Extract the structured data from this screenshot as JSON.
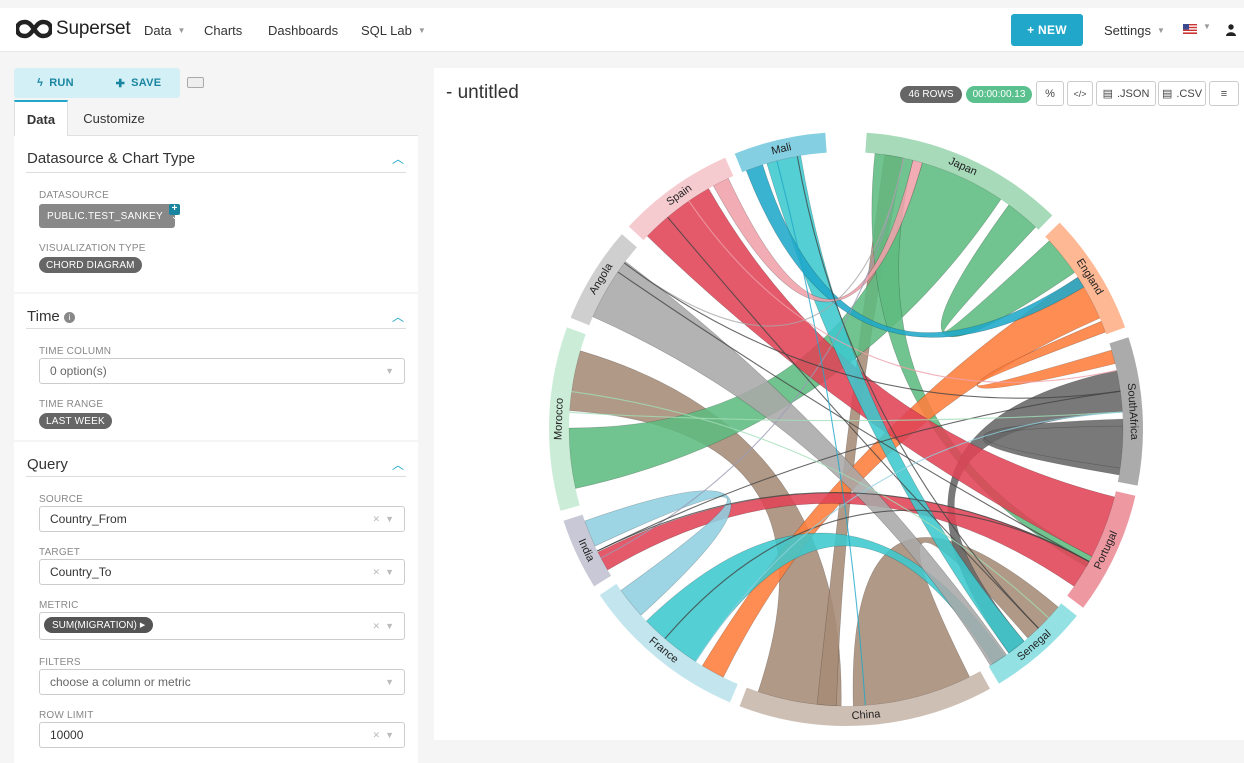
{
  "nav": {
    "brand": "Superset",
    "items": [
      "Data",
      "Charts",
      "Dashboards",
      "SQL Lab"
    ],
    "new_label": "+ NEW",
    "settings_label": "Settings"
  },
  "controls": {
    "run_label": "RUN",
    "save_label": "SAVE",
    "tabs": [
      "Data",
      "Customize"
    ]
  },
  "sections": {
    "datasource": {
      "title": "Datasource & Chart Type",
      "datasource_label": "DATASOURCE",
      "datasource_value": "PUBLIC.TEST_SANKEY",
      "viz_label": "VISUALIZATION TYPE",
      "viz_value": "CHORD DIAGRAM"
    },
    "time": {
      "title": "Time",
      "column_label": "TIME COLUMN",
      "column_value": "0 option(s)",
      "range_label": "TIME RANGE",
      "range_value": "LAST WEEK"
    },
    "query": {
      "title": "Query",
      "source_label": "SOURCE",
      "source_value": "Country_From",
      "target_label": "TARGET",
      "target_value": "Country_To",
      "metric_label": "METRIC",
      "metric_value": "SUM(MIGRATION)",
      "filters_label": "FILTERS",
      "filters_placeholder": "choose a column or metric",
      "row_limit_label": "ROW LIMIT",
      "row_limit_value": "10000"
    }
  },
  "chart_header": {
    "title": "- untitled",
    "rows_badge": "46 ROWS",
    "time_badge": "00:00:00.13",
    "json_label": ".JSON",
    "csv_label": ".CSV"
  },
  "chart_data": {
    "type": "chord",
    "groups": [
      {
        "name": "Japan",
        "color": "#5dbb7f"
      },
      {
        "name": "England",
        "color": "#fe7d3c"
      },
      {
        "name": "SouthAfrica",
        "color": "#666666"
      },
      {
        "name": "Portugal",
        "color": "#e04355"
      },
      {
        "name": "Senegal",
        "color": "#3cc8cd"
      },
      {
        "name": "China",
        "color": "#a68b76"
      },
      {
        "name": "France",
        "color": "#8fcfe0"
      },
      {
        "name": "India",
        "color": "#9a9bb5"
      },
      {
        "name": "Morocco",
        "color": "#a1ddb7"
      },
      {
        "name": "Angola",
        "color": "#a8a8a8"
      },
      {
        "name": "Spain",
        "color": "#efa1aa"
      },
      {
        "name": "Mali",
        "color": "#1fa8c9"
      }
    ]
  }
}
